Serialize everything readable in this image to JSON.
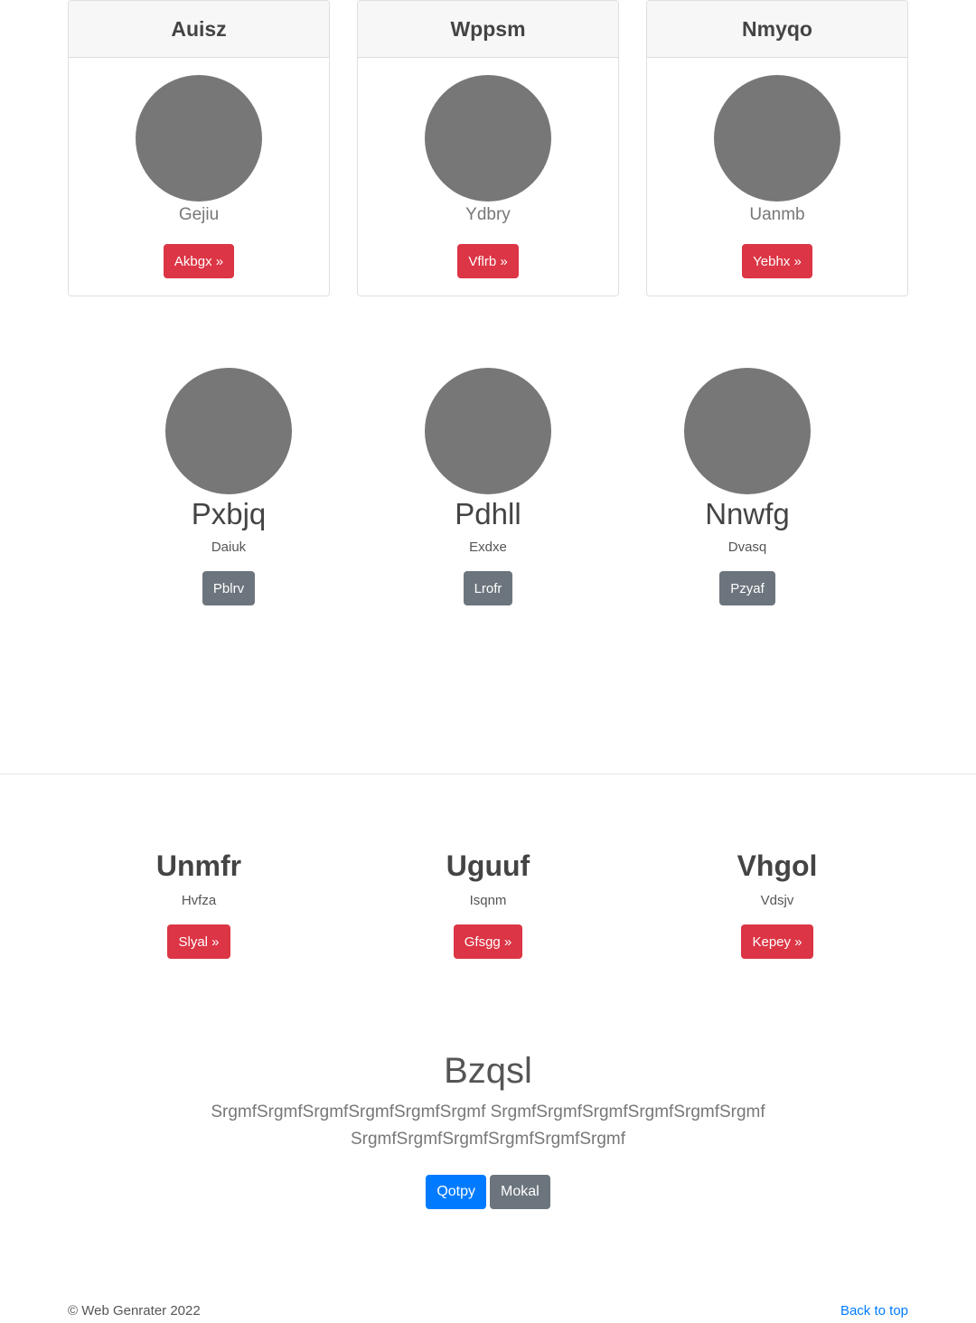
{
  "cards": [
    {
      "title": "Auisz",
      "subtitle": "Gejiu",
      "button": "Akbgx »"
    },
    {
      "title": "Wppsm",
      "subtitle": "Ydbry",
      "button": "Vflrb »"
    },
    {
      "title": "Nmyqo",
      "subtitle": "Uanmb",
      "button": "Yebhx »"
    }
  ],
  "featurettes": [
    {
      "title": "Pxbjq",
      "text": "Daiuk",
      "button": "Pblrv"
    },
    {
      "title": "Pdhll",
      "text": "Exdxe",
      "button": "Lrofr"
    },
    {
      "title": "Nnwfg",
      "text": "Dvasq",
      "button": "Pzyaf"
    }
  ],
  "columns": [
    {
      "title": "Unmfr",
      "text": "Hvfza",
      "button": "Slyal »"
    },
    {
      "title": "Uguuf",
      "text": "Isqnm",
      "button": "Gfsgg »"
    },
    {
      "title": "Vhgol",
      "text": "Vdsjv",
      "button": "Kepey »"
    }
  ],
  "jumbotron": {
    "title": "Bzqsl",
    "lead": "SrgmfSrgmfSrgmfSrgmfSrgmfSrgmf SrgmfSrgmfSrgmfSrgmfSrgmfSrgmf SrgmfSrgmfSrgmfSrgmfSrgmfSrgmf",
    "primary_button": "Qotpy",
    "secondary_button": "Mokal"
  },
  "footer": {
    "copyright": "© Web Genrater 2022",
    "back_to_top": "Back to top"
  },
  "colors": {
    "danger": "#dc3545",
    "secondary": "#6c757d",
    "primary": "#007bff",
    "placeholder": "#777777"
  }
}
